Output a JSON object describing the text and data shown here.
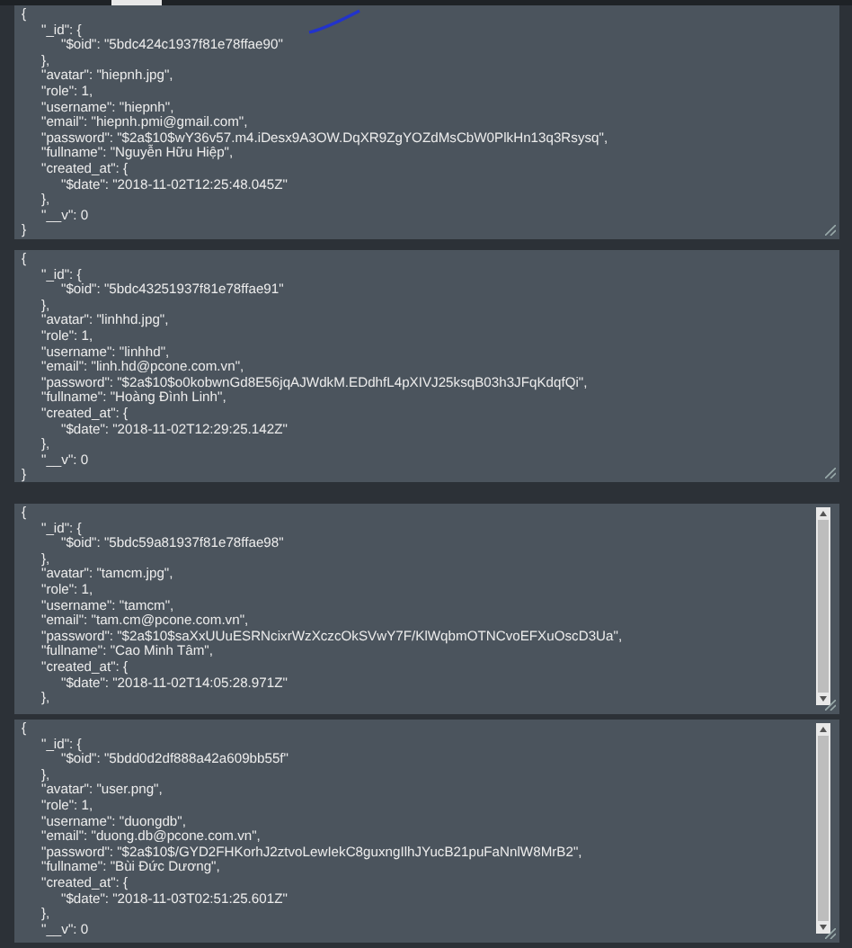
{
  "documents": [
    {
      "scrollbar": false,
      "lines": [
        {
          "text": "{",
          "children": [
            {
              "text": "\"_id\": {",
              "children": [
                {
                  "text": "\"$oid\": \"5bdc424c1937f81e78ffae90\""
                }
              ]
            },
            {
              "text": "},"
            },
            {
              "text": "\"avatar\": \"hiepnh.jpg\","
            },
            {
              "text": "\"role\": 1,"
            },
            {
              "text": "\"username\": \"hiepnh\","
            },
            {
              "text": "\"email\": \"hiepnh.pmi@gmail.com\","
            },
            {
              "text": "\"password\": \"$2a$10$wY36v57.m4.iDesx9A3OW.DqXR9ZgYOZdMsCbW0PlkHn13q3Rsysq\","
            },
            {
              "text": "\"fullname\": \"Nguyễn Hữu Hiệp\","
            },
            {
              "text": "\"created_at\": {",
              "children": [
                {
                  "text": "\"$date\": \"2018-11-02T12:25:48.045Z\""
                }
              ]
            },
            {
              "text": "},"
            },
            {
              "text": "\"__v\": 0"
            }
          ]
        },
        {
          "text": "}"
        }
      ]
    },
    {
      "scrollbar": false,
      "lines": [
        {
          "text": "{",
          "children": [
            {
              "text": "\"_id\": {",
              "children": [
                {
                  "text": "\"$oid\": \"5bdc43251937f81e78ffae91\""
                }
              ]
            },
            {
              "text": "},"
            },
            {
              "text": "\"avatar\": \"linhhd.jpg\","
            },
            {
              "text": "\"role\": 1,"
            },
            {
              "text": "\"username\": \"linhhd\","
            },
            {
              "text": "\"email\": \"linh.hd@pcone.com.vn\","
            },
            {
              "text": "\"password\": \"$2a$10$o0kobwnGd8E56jqAJWdkM.EDdhfL4pXIVJ25ksqB03h3JFqKdqfQi\","
            },
            {
              "text": "\"fullname\": \"Hoàng Đình Linh\","
            },
            {
              "text": "\"created_at\": {",
              "children": [
                {
                  "text": "\"$date\": \"2018-11-02T12:29:25.142Z\""
                }
              ]
            },
            {
              "text": "},"
            },
            {
              "text": "\"__v\": 0"
            }
          ]
        },
        {
          "text": "}"
        }
      ]
    },
    {
      "scrollbar": true,
      "lines": [
        {
          "text": "{",
          "children": [
            {
              "text": "\"_id\": {",
              "children": [
                {
                  "text": "\"$oid\": \"5bdc59a81937f81e78ffae98\""
                }
              ]
            },
            {
              "text": "},"
            },
            {
              "text": "\"avatar\": \"tamcm.jpg\","
            },
            {
              "text": "\"role\": 1,"
            },
            {
              "text": "\"username\": \"tamcm\","
            },
            {
              "text": "\"email\": \"tam.cm@pcone.com.vn\","
            },
            {
              "text": "\"password\": \"$2a$10$saXxUUuESRNcixrWzXczcOkSVwY7F/KlWqbmOTNCvoEFXuOscD3Ua\","
            },
            {
              "text": "\"fullname\": \"Cao Minh Tâm\","
            },
            {
              "text": "\"created_at\": {",
              "children": [
                {
                  "text": "\"$date\": \"2018-11-02T14:05:28.971Z\""
                }
              ]
            },
            {
              "text": "},"
            }
          ]
        }
      ]
    },
    {
      "scrollbar": true,
      "lines": [
        {
          "text": "{",
          "children": [
            {
              "text": "\"_id\": {",
              "children": [
                {
                  "text": "\"$oid\": \"5bdd0d2df888a42a609bb55f\""
                }
              ]
            },
            {
              "text": "},"
            },
            {
              "text": "\"avatar\": \"user.png\","
            },
            {
              "text": "\"role\": 1,"
            },
            {
              "text": "\"username\": \"duongdb\","
            },
            {
              "text": "\"email\": \"duong.db@pcone.com.vn\","
            },
            {
              "text": "\"password\": \"$2a$10$/GYD2FHKorhJ2ztvoLewIekC8guxngIlhJYucB21puFaNnlW8MrB2\","
            },
            {
              "text": "\"fullname\": \"Bùi Đức Dương\","
            },
            {
              "text": "\"created_at\": {",
              "children": [
                {
                  "text": "\"$date\": \"2018-11-03T02:51:25.601Z\""
                }
              ]
            },
            {
              "text": "},"
            },
            {
              "text": "\"__v\": 0"
            }
          ]
        }
      ]
    }
  ]
}
